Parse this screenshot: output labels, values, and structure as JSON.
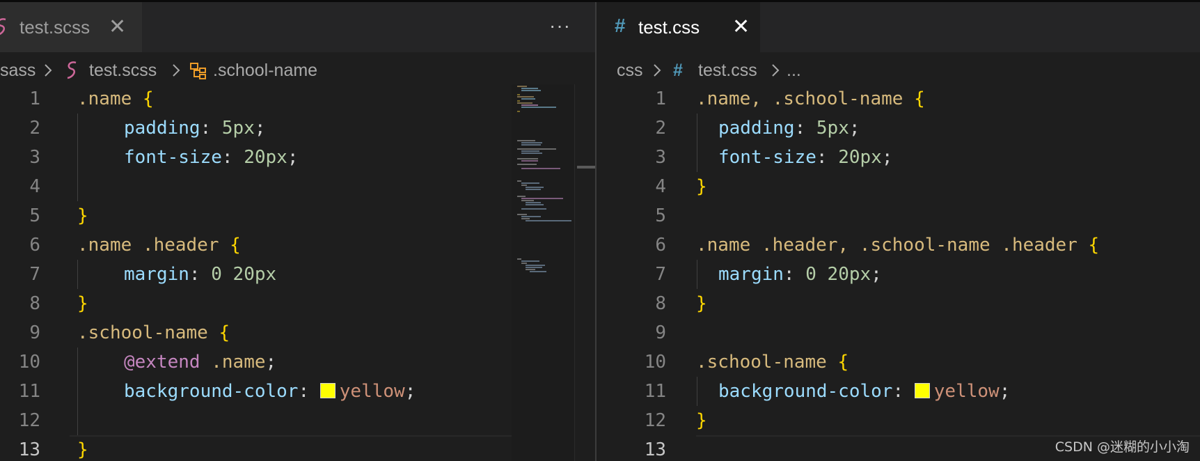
{
  "left_editor": {
    "tab": {
      "label": "test.scss",
      "icon": "sass-icon"
    },
    "breadcrumb": [
      "sass",
      "test.scss",
      ".school-name"
    ],
    "more_actions": "···",
    "line_numbers": [
      "1",
      "2",
      "3",
      "4",
      "5",
      "6",
      "7",
      "8",
      "9",
      "10",
      "11",
      "12",
      "13"
    ],
    "active_line": "13",
    "code": {
      "l1_sel": ".name",
      "l1_brace": "{",
      "l2_prop": "padding",
      "l2_colon": ": ",
      "l2_val": "5px",
      "l2_semi": ";",
      "l3_prop": "font-size",
      "l3_colon": ": ",
      "l3_val": "20px",
      "l3_semi": ";",
      "l5_brace": "}",
      "l6_sel": ".name .header",
      "l6_brace": "{",
      "l7_prop": "margin",
      "l7_colon": ": ",
      "l7_val": "0 20px",
      "l8_brace": "}",
      "l9_sel": ".school-name",
      "l9_brace": "{",
      "l10_kw": "@extend",
      "l10_sel": ".name",
      "l10_semi": ";",
      "l11_prop": "background-color",
      "l11_colon": ": ",
      "l11_val": "yellow",
      "l11_semi": ";",
      "l13_brace": "}"
    }
  },
  "right_editor": {
    "tab": {
      "label": "test.css",
      "icon_glyph": "#",
      "close": "✕"
    },
    "breadcrumb": [
      "css",
      "test.css",
      "..."
    ],
    "line_numbers": [
      "1",
      "2",
      "3",
      "4",
      "5",
      "6",
      "7",
      "8",
      "9",
      "10",
      "11",
      "12",
      "13"
    ],
    "active_line": "13",
    "code": {
      "l1_sel": ".name, .school-name",
      "l1_brace": "{",
      "l2_prop": "padding",
      "l2_colon": ": ",
      "l2_val": "5px",
      "l2_semi": ";",
      "l3_prop": "font-size",
      "l3_colon": ": ",
      "l3_val": "20px",
      "l3_semi": ";",
      "l4_brace": "}",
      "l6_sel": ".name .header, .school-name .header",
      "l6_brace": "{",
      "l7_prop": "margin",
      "l7_colon": ": ",
      "l7_val": "0 20px",
      "l7_semi": ";",
      "l8_brace": "}",
      "l10_sel": ".school-name",
      "l10_brace": "{",
      "l11_prop": "background-color",
      "l11_colon": ": ",
      "l11_val": "yellow",
      "l11_semi": ";",
      "l12_brace": "}"
    }
  },
  "left_close": "✕",
  "watermark": "CSDN @迷糊的小小淘",
  "colors": {
    "background": "#1e1e1e",
    "selector": "#d7ba7d",
    "brace": "#ffd700",
    "property": "#9cdcfe",
    "number": "#b5cea8",
    "keyword": "#c586c0",
    "string": "#ce9178",
    "swatch_yellow": "#ffff00",
    "sass_pink": "#cd6799",
    "css_blue": "#519aba"
  }
}
